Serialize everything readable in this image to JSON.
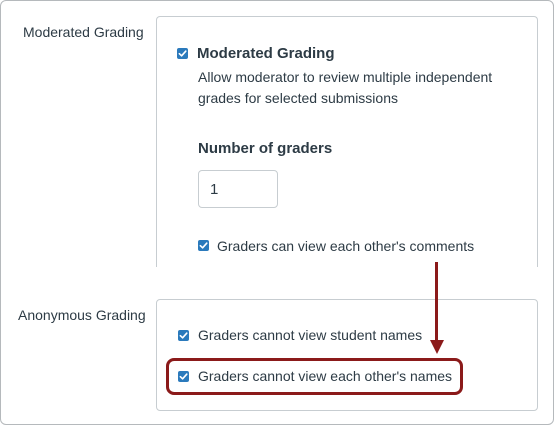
{
  "moderated": {
    "section_label": "Moderated Grading",
    "checkbox_label": "Moderated Grading",
    "checked": true,
    "description": "Allow moderator to review multiple independent grades for selected submissions",
    "graders_heading": "Number of graders",
    "graders_value": "1",
    "comments_label": "Graders can view each other's comments",
    "comments_checked": true
  },
  "anonymous": {
    "section_label": "Anonymous Grading",
    "student_names_label": "Graders cannot view student names",
    "student_names_checked": true,
    "other_names_label": "Graders cannot view each other's names",
    "other_names_checked": true
  },
  "colors": {
    "checkbox": "#2b7abc",
    "annotation": "#8b1a1a",
    "text": "#2d3b45"
  }
}
